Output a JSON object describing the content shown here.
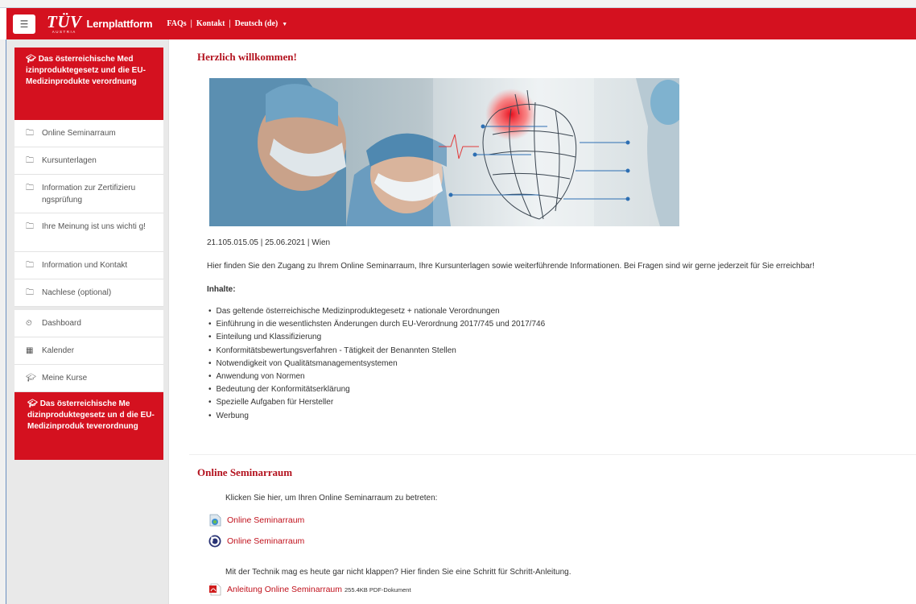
{
  "navbar": {
    "menu_icon": "hamburger-icon",
    "brand_logo": "TÜV",
    "brand_sub": "AUSTRIA",
    "brand_name": "Lernplattform",
    "links": [
      "FAQs",
      "Kontakt",
      "Deutsch (de)"
    ],
    "separator": "|",
    "lang_caret_icon": "caret-down-icon",
    "accent_color": "#d4111f"
  },
  "sidebar": {
    "course_title_top": "Das österreichische Med izinproduktegesetz und die EU-Medizinprodukte verordnung",
    "sections": [
      {
        "icon": "folder-icon",
        "label": "Online Seminarraum"
      },
      {
        "icon": "folder-icon",
        "label": "Kursunterlagen"
      },
      {
        "icon": "folder-icon",
        "label": "Information zur Zertifizieru ngsprüfung"
      },
      {
        "icon": "folder-icon",
        "label": "Ihre Meinung ist uns wichti g!"
      },
      {
        "icon": "folder-icon",
        "label": "Information und Kontakt"
      },
      {
        "icon": "folder-icon",
        "label": "Nachlese (optional)"
      }
    ],
    "nav": [
      {
        "icon": "dashboard-icon",
        "label": "Dashboard"
      },
      {
        "icon": "calendar-icon",
        "label": "Kalender"
      },
      {
        "icon": "graduation-cap-icon",
        "label": "Meine Kurse"
      }
    ],
    "course_title_bottom": "Das österreichische Me dizinproduktegesetz un d die EU-Medizinproduk teverordnung"
  },
  "main": {
    "welcome_heading": "Herzlich willkommen!",
    "meta": "21.105.015.05 | 25.06.2021 | Wien",
    "intro": "Hier finden Sie den Zugang zu Ihrem Online Seminarraum, Ihre Kursunterlagen sowie weiterführende Informationen. Bei Fragen sind wir gerne jederzeit für Sie erreichbar!",
    "inhalte_label": "Inhalte:",
    "topics": [
      "Das geltende österreichische Medizinproduktegesetz + nationale Verordnungen",
      "Einführung in die wesentlichsten Änderungen durch EU-Verordnung 2017/745 und 2017/746",
      "Einteilung und Klassifizierung",
      "Konformitätsbewertungsverfahren - Tätigkeit der Benannten Stellen",
      "Notwendigkeit von Qualitätsmanagementsystemen",
      "Anwendung von Normen",
      "Bedeutung der Konformitätserklärung",
      "Spezielle Aufgaben für Hersteller",
      "Werbung"
    ],
    "seminar_heading": "Online Seminarraum",
    "click_text": "Klicken Sie hier, um Ihren Online Seminarraum zu betreten:",
    "seminar_links": [
      {
        "icon": "webinar-app-icon",
        "label": "Online Seminarraum"
      },
      {
        "icon": "bigbluebutton-icon",
        "label": "Online Seminarraum"
      }
    ],
    "tech_text": "Mit der Technik mag es heute gar nicht klappen? Hier finden Sie eine Schritt für Schritt-Anleitung.",
    "pdf_link": {
      "icon": "pdf-icon",
      "label": "Anleitung Online Seminarraum",
      "meta": "255.4KB PDF-Dokument"
    }
  }
}
